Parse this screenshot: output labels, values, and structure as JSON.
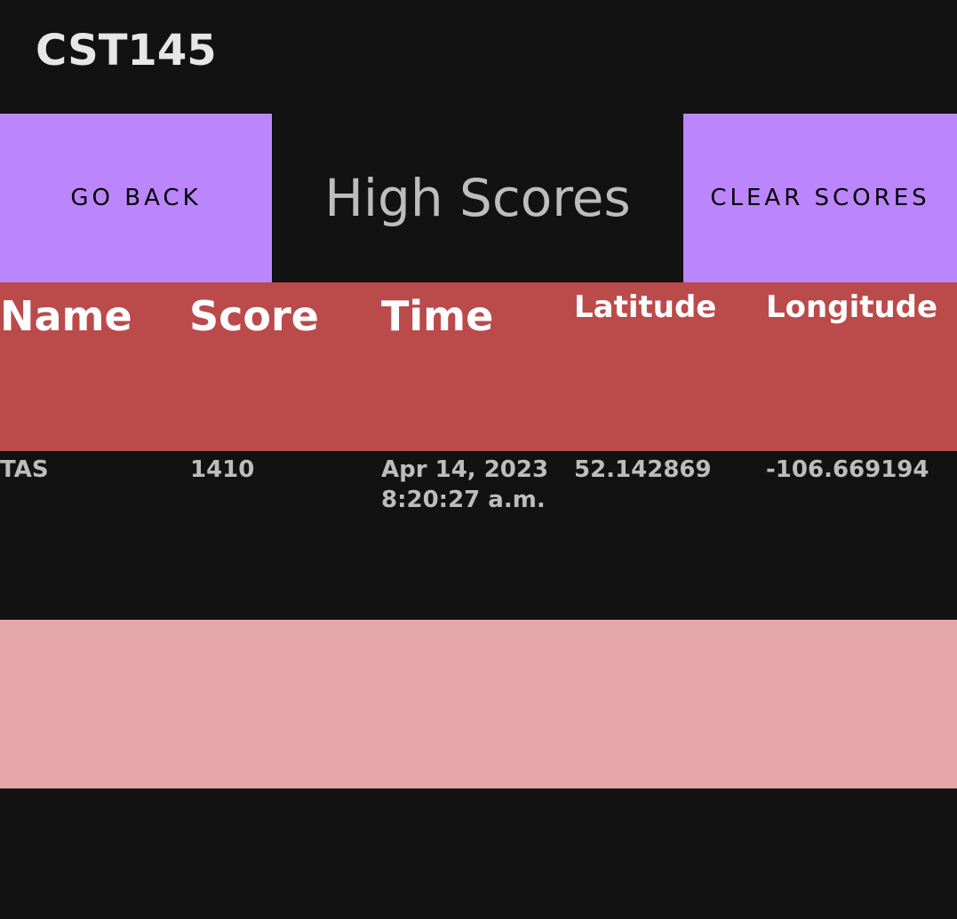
{
  "app_bar": {
    "title": "CST145"
  },
  "toolbar": {
    "go_back_label": "GO BACK",
    "heading": "High Scores",
    "clear_scores_label": "CLEAR SCORES"
  },
  "table": {
    "columns": [
      "Name",
      "Score",
      "Time",
      "Latitude",
      "Longitude"
    ],
    "rows": [
      {
        "name": "TAS",
        "score": "1410",
        "time": "Apr 14, 2023\n8:20:27 a.m.",
        "latitude": "52.142869",
        "longitude": "-106.669194"
      }
    ]
  },
  "colors": {
    "accent": "#bb86fc",
    "header_row": "#bb4a4b",
    "empty_row": "#e5a6a7",
    "background": "#121212"
  }
}
